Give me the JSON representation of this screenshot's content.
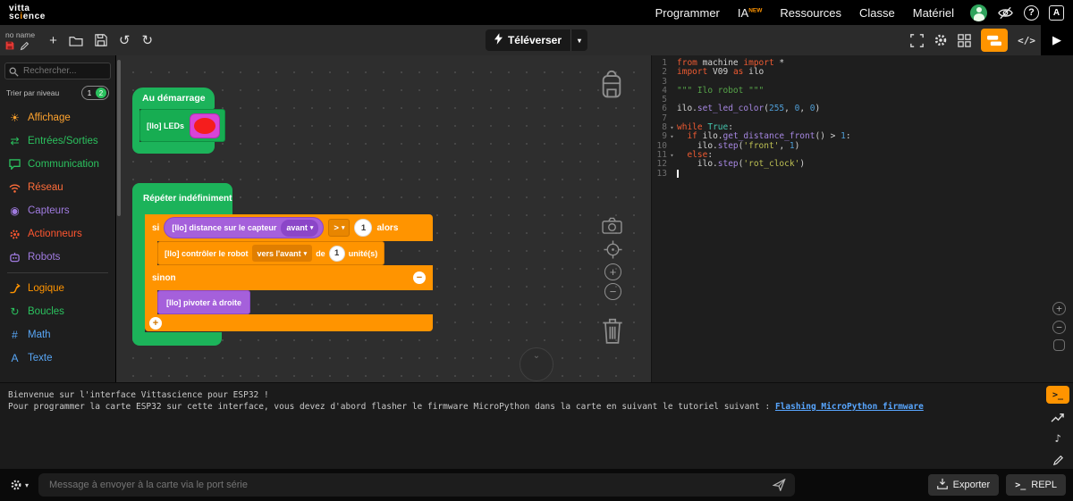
{
  "topbar": {
    "logo_line1": "vitta",
    "logo_line2_pre": "sc",
    "logo_dot": "i",
    "logo_line2_post": "ence",
    "nav": [
      "Programmer",
      "IA",
      "Ressources",
      "Classe",
      "Matériel"
    ],
    "ia_badge": "NEW"
  },
  "toolbar": {
    "project_name": "no name",
    "upload_label": "Téléverser",
    "code_toggle_label": "</>"
  },
  "sidebar": {
    "search_placeholder": "Rechercher...",
    "sort_label": "Trier par niveau",
    "levels": [
      "1",
      "2"
    ],
    "categories": [
      {
        "id": "affichage",
        "label": "Affichage",
        "color": "#ffa32e",
        "icon": "sun-icon"
      },
      {
        "id": "entrees-sorties",
        "label": "Entrées/Sorties",
        "color": "#2bc15e",
        "icon": "swap-icon"
      },
      {
        "id": "communication",
        "label": "Communication",
        "color": "#2bc15e",
        "icon": "chat-icon"
      },
      {
        "id": "reseau",
        "label": "Réseau",
        "color": "#ff6d3a",
        "icon": "wifi-icon"
      },
      {
        "id": "capteurs",
        "label": "Capteurs",
        "color": "#a07be0",
        "icon": "sensor-icon"
      },
      {
        "id": "actionneurs",
        "label": "Actionneurs",
        "color": "#ff5630",
        "icon": "motor-icon"
      },
      {
        "id": "robots",
        "label": "Robots",
        "color": "#a07be0",
        "icon": "robot-icon",
        "divider_after": true
      },
      {
        "id": "logique",
        "label": "Logique",
        "color": "#ff9400",
        "icon": "branch-icon"
      },
      {
        "id": "boucles",
        "label": "Boucles",
        "color": "#2bc15e",
        "icon": "loop-icon"
      },
      {
        "id": "math",
        "label": "Math",
        "color": "#58a6f5",
        "icon": "hash-icon"
      },
      {
        "id": "texte",
        "label": "Texte",
        "color": "#58a6f5",
        "icon": "text-icon"
      }
    ]
  },
  "canvas": {
    "start_label": "Au démarrage",
    "leds_label": "[Ilo] LEDs",
    "repeat_label": "Répéter indéfiniment",
    "if_label": "si",
    "then_label": "alors",
    "else_label": "sinon",
    "distance_label": "[Ilo] distance sur le capteur",
    "distance_option": "avant",
    "comparator": ">",
    "if_value": "1",
    "move_label": "[Ilo] contrôler le robot",
    "move_option": "vers l'avant",
    "of_label": "de",
    "move_value": "1",
    "units_label": "unité(s)",
    "rotate_label": "[Ilo] pivoter à droite",
    "collapse_glyph": "−",
    "expand_glyph": "+"
  },
  "code": {
    "lines": [
      {
        "n": "1",
        "tokens": [
          {
            "c": "k",
            "t": "from"
          },
          {
            "c": "p",
            "t": " machine "
          },
          {
            "c": "k",
            "t": "import"
          },
          {
            "c": "p",
            "t": " *"
          }
        ]
      },
      {
        "n": "2",
        "tokens": [
          {
            "c": "k",
            "t": "import"
          },
          {
            "c": "p",
            "t": " V09 "
          },
          {
            "c": "k",
            "t": "as"
          },
          {
            "c": "p",
            "t": " ilo"
          }
        ]
      },
      {
        "n": "3",
        "tokens": []
      },
      {
        "n": "4",
        "tokens": [
          {
            "c": "d",
            "t": "\"\"\" Ilo robot \"\"\""
          }
        ]
      },
      {
        "n": "5",
        "tokens": []
      },
      {
        "n": "6",
        "tokens": [
          {
            "c": "p",
            "t": "ilo."
          },
          {
            "c": "m",
            "t": "set_led_color"
          },
          {
            "c": "p",
            "t": "("
          },
          {
            "c": "n",
            "t": "255"
          },
          {
            "c": "p",
            "t": ", "
          },
          {
            "c": "n",
            "t": "0"
          },
          {
            "c": "p",
            "t": ", "
          },
          {
            "c": "n",
            "t": "0"
          },
          {
            "c": "p",
            "t": ")"
          }
        ]
      },
      {
        "n": "7",
        "tokens": []
      },
      {
        "n": "8",
        "fold": true,
        "tokens": [
          {
            "c": "k",
            "t": "while"
          },
          {
            "c": "p",
            "t": " "
          },
          {
            "c": "b",
            "t": "True"
          },
          {
            "c": "p",
            "t": ":"
          }
        ]
      },
      {
        "n": "9",
        "fold": true,
        "tokens": [
          {
            "c": "p",
            "t": "  "
          },
          {
            "c": "k",
            "t": "if"
          },
          {
            "c": "p",
            "t": " ilo."
          },
          {
            "c": "m",
            "t": "get_distance_front"
          },
          {
            "c": "p",
            "t": "() > "
          },
          {
            "c": "n",
            "t": "1"
          },
          {
            "c": "p",
            "t": ":"
          }
        ]
      },
      {
        "n": "10",
        "tokens": [
          {
            "c": "p",
            "t": "    ilo."
          },
          {
            "c": "m",
            "t": "step"
          },
          {
            "c": "p",
            "t": "("
          },
          {
            "c": "s",
            "t": "'front'"
          },
          {
            "c": "p",
            "t": ", "
          },
          {
            "c": "n",
            "t": "1"
          },
          {
            "c": "p",
            "t": ")"
          }
        ]
      },
      {
        "n": "11",
        "fold": true,
        "tokens": [
          {
            "c": "p",
            "t": "  "
          },
          {
            "c": "k",
            "t": "else"
          },
          {
            "c": "p",
            "t": ":"
          }
        ]
      },
      {
        "n": "12",
        "tokens": [
          {
            "c": "p",
            "t": "    ilo."
          },
          {
            "c": "m",
            "t": "step"
          },
          {
            "c": "p",
            "t": "("
          },
          {
            "c": "s",
            "t": "'rot_clock'"
          },
          {
            "c": "p",
            "t": ")"
          }
        ]
      },
      {
        "n": "13",
        "cursor": true,
        "tokens": []
      }
    ]
  },
  "console": {
    "line1": "Bienvenue sur l'interface Vittascience pour ESP32 !",
    "line2_prefix": "Pour programmer la carte ESP32 sur cette interface, vous devez d'abord flasher le firmware MicroPython dans la carte en suivant le tutoriel suivant : ",
    "line2_link": "Flashing MicroPython firmware",
    "toggle_label": ">_"
  },
  "bottombar": {
    "message_placeholder": "Message à envoyer à la carte via le port série",
    "export_label": "Exporter",
    "repl_label": "REPL",
    "repl_icon": ">_"
  },
  "colors": {
    "accent_orange": "#ff9400",
    "block_green": "#1cb35a",
    "block_orange": "#ff9400",
    "block_purple": "#a560db",
    "led_magenta": "#d844d8",
    "led_red": "#f51d1d"
  }
}
